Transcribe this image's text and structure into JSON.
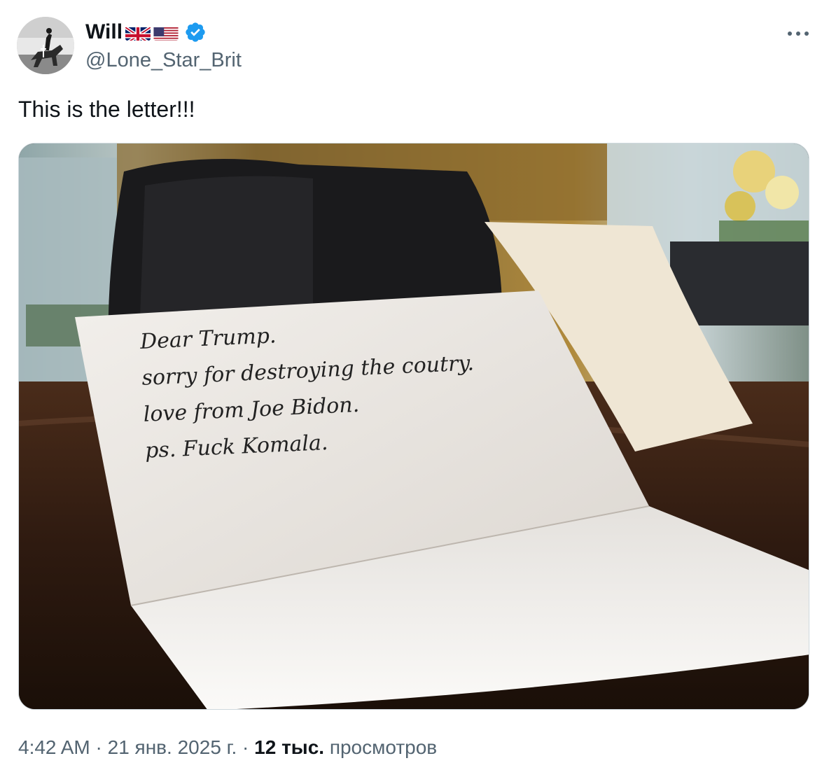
{
  "author": {
    "display_name": "Will",
    "handle": "@Lone_Star_Brit",
    "flags": [
      "uk-flag-icon",
      "us-flag-icon"
    ],
    "verified": true
  },
  "tweet": {
    "text": "This is the letter!!!"
  },
  "image": {
    "letter_lines": [
      "Dear Trump.",
      "sorry for destroying the coutry.",
      "love from Joe Bidon.",
      "ps. Fuck Komala."
    ]
  },
  "meta": {
    "time": "4:42 AM",
    "sep1": " · ",
    "date": "21 янв. 2025 г.",
    "sep2": " · ",
    "views_count": "12 тыс.",
    "views_label": " просмотров"
  },
  "colors": {
    "verified_blue": "#1d9bf0",
    "secondary_text": "#536471"
  }
}
